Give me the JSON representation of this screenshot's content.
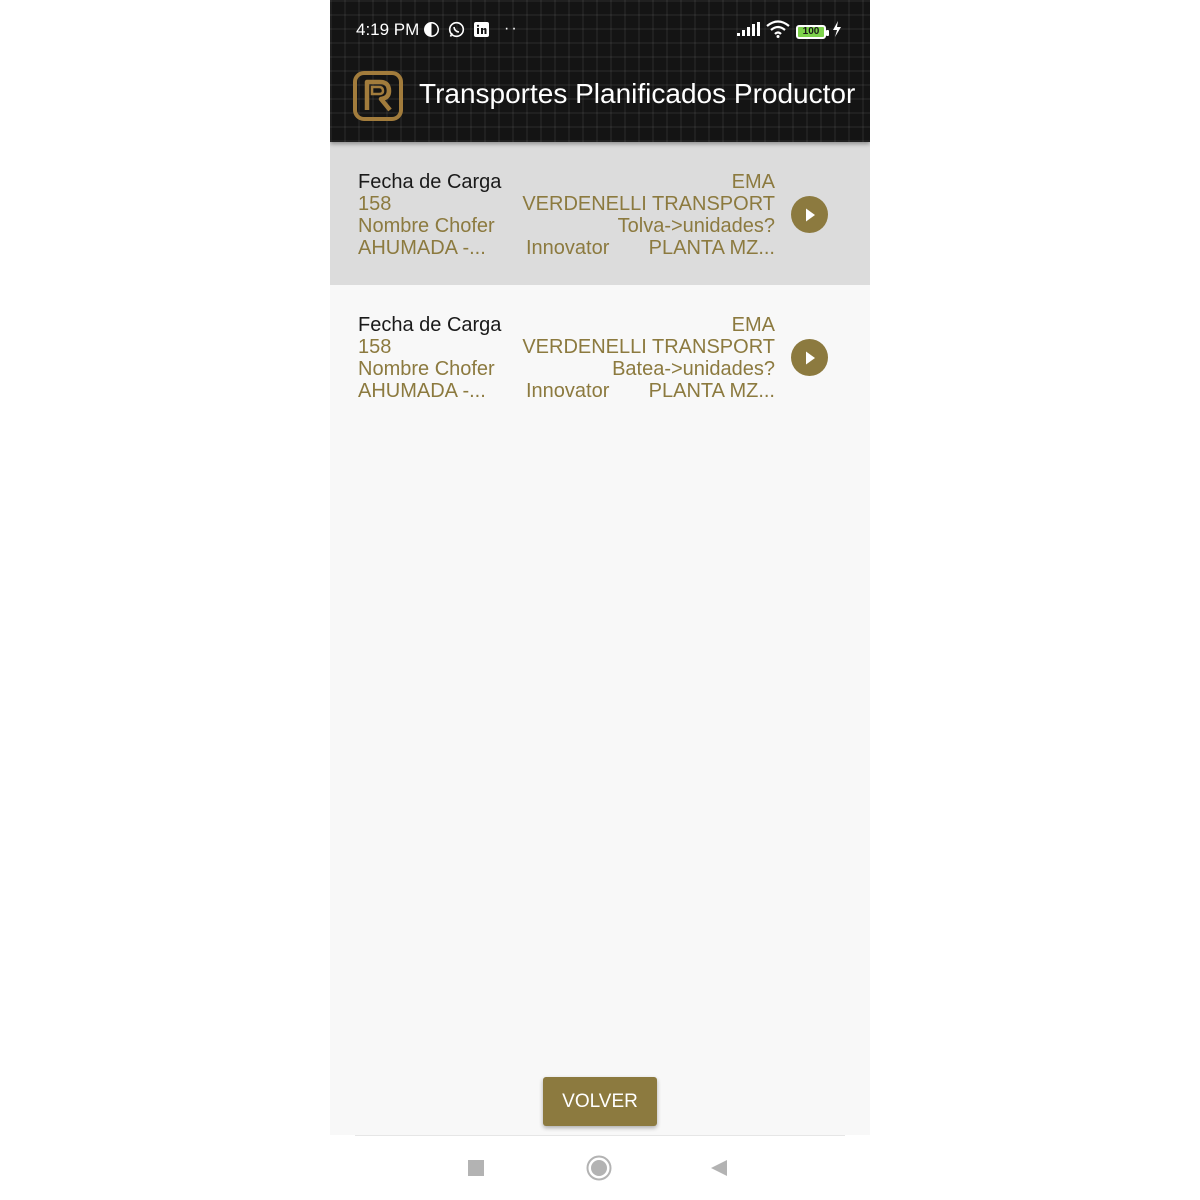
{
  "status_bar": {
    "time": "4:19 PM",
    "battery": "100"
  },
  "app_bar": {
    "title": "Transportes Planificados Productor"
  },
  "transports": [
    {
      "fecha_label": "Fecha de Carga",
      "numero": "158",
      "chofer_label": "Nombre Chofer",
      "chofer": "AHUMADA -...",
      "producto": "Innovator",
      "empresa": "EMA",
      "transporte": "VERDENELLI TRANSPORT",
      "unidad": "Tolva->unidades?",
      "planta": "PLANTA MZ...",
      "selected": true
    },
    {
      "fecha_label": "Fecha de Carga",
      "numero": "158",
      "chofer_label": "Nombre Chofer",
      "chofer": "AHUMADA -...",
      "producto": "Innovator",
      "empresa": "EMA",
      "transporte": "VERDENELLI TRANSPORT",
      "unidad": "Batea->unidades?",
      "planta": "PLANTA MZ...",
      "selected": false
    }
  ],
  "actions": {
    "volver_label": "VOLVER"
  },
  "colors": {
    "accent": "#8c7a3f",
    "header_bg": "#141414",
    "selected_row": "#dcdcdc",
    "background": "#f8f8f8"
  },
  "icons": {
    "logo": "app-logo-icon",
    "play": "play-circle-icon",
    "nav_recents": "square-icon",
    "nav_home": "circle-icon",
    "nav_back": "triangle-back-icon"
  }
}
